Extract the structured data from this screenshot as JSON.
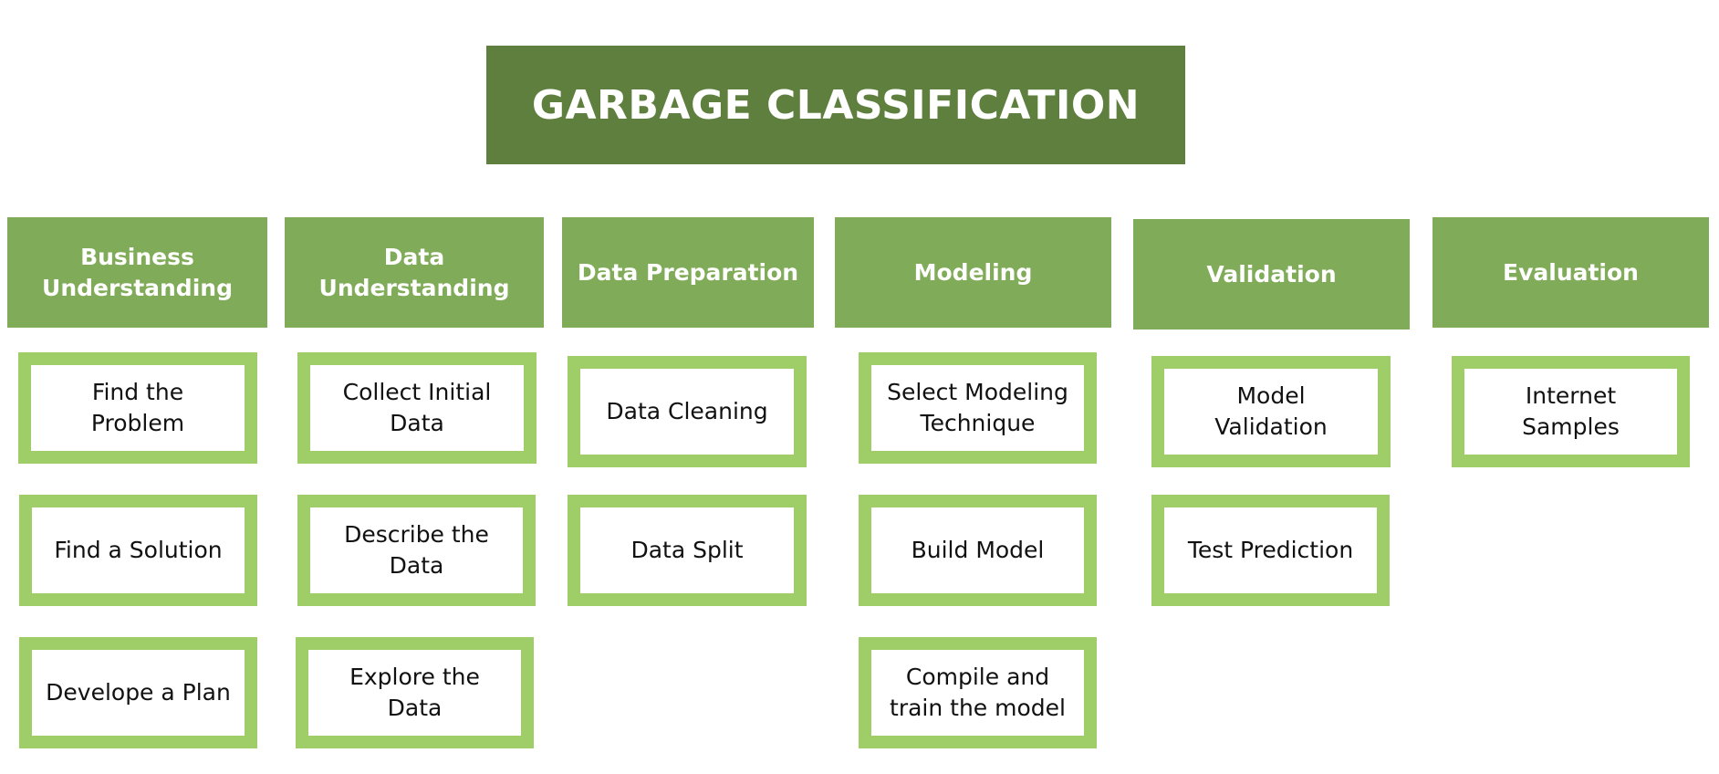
{
  "title": "GARBAGE CLASSIFICATION",
  "colors": {
    "title_bg": "#5e7f3e",
    "header_bg": "#80ab58",
    "item_border": "#9fcd67",
    "item_text": "#111111"
  },
  "columns": [
    {
      "header": "Business Understanding",
      "items": [
        "Find the Problem",
        "Find a Solution",
        "Develope a Plan"
      ]
    },
    {
      "header": "Data Understanding",
      "items": [
        "Collect Initial Data",
        "Describe the Data",
        "Explore the Data"
      ]
    },
    {
      "header": "Data Preparation",
      "items": [
        "Data Cleaning",
        "Data Split"
      ]
    },
    {
      "header": "Modeling",
      "items": [
        "Select Modeling Technique",
        "Build Model",
        "Compile and train the model"
      ]
    },
    {
      "header": "Validation",
      "items": [
        "Model Validation",
        "Test Prediction"
      ]
    },
    {
      "header": "Evaluation",
      "items": [
        "Internet Samples"
      ]
    }
  ]
}
